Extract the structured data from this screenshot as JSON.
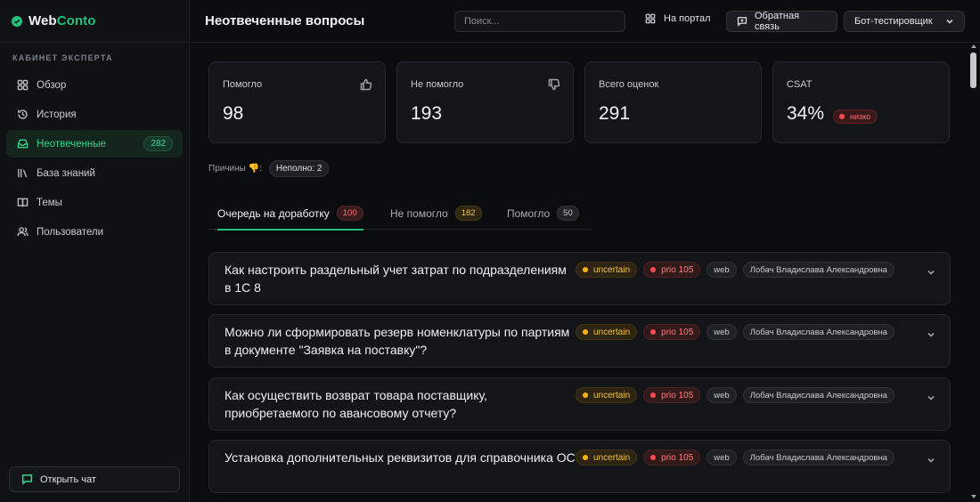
{
  "brand": {
    "name_part1": "Web",
    "name_part2": "Conto"
  },
  "sidebar": {
    "section_label": "КАБИНЕТ ЭКСПЕРТА",
    "items": [
      {
        "label": "Обзор",
        "icon": "grid-icon"
      },
      {
        "label": "История",
        "icon": "history-icon"
      },
      {
        "label": "Неотвеченные",
        "icon": "inbox-icon",
        "count": "282",
        "active": true
      },
      {
        "label": "База знаний",
        "icon": "library-icon"
      },
      {
        "label": "Темы",
        "icon": "book-icon"
      },
      {
        "label": "Пользователи",
        "icon": "users-icon"
      }
    ],
    "open_chat_label": "Открыть чат"
  },
  "header": {
    "title": "Неотвеченные вопросы",
    "search_placeholder": "Поиск...",
    "portal_link": "На портал",
    "feedback_button": "Обратная связь",
    "bot_select": "Бот-тестировщик"
  },
  "stats": {
    "helped": {
      "label": "Помогло",
      "value": "98"
    },
    "not_helped": {
      "label": "Не помогло",
      "value": "193"
    },
    "total": {
      "label": "Всего оценок",
      "value": "291"
    },
    "csat": {
      "label": "CSAT",
      "value": "34%",
      "badge": "низко"
    }
  },
  "reasons": {
    "label": "Причины 👎:",
    "chip": "Неполно: 2"
  },
  "tabs": [
    {
      "label": "Очередь на доработку",
      "count": "100",
      "active": true
    },
    {
      "label": "Не помогло",
      "count": "182"
    },
    {
      "label": "Помогло",
      "count": "50"
    }
  ],
  "questions": [
    {
      "title": "Как настроить раздельный учет затрат по подразделениям в 1С 8",
      "status": "uncertain",
      "prio": "prio 105",
      "channel": "web",
      "user": "Лобач Владислава Александровна"
    },
    {
      "title": "Можно ли сформировать резерв номенклатуры по партиям в документе \"Заявка на поставку\"?",
      "status": "uncertain",
      "prio": "prio 105",
      "channel": "web",
      "user": "Лобач Владислава Александровна"
    },
    {
      "title": "Как осуществить возврат товара поставщику, приобретаемого по авансовому отчету?",
      "status": "uncertain",
      "prio": "prio 105",
      "channel": "web",
      "user": "Лобач Владислава Александровна"
    },
    {
      "title": "Установка дополнительных реквизитов для справочника ОС",
      "status": "uncertain",
      "prio": "prio 105",
      "channel": "web",
      "user": "Лобач Владислава Александровна"
    }
  ]
}
